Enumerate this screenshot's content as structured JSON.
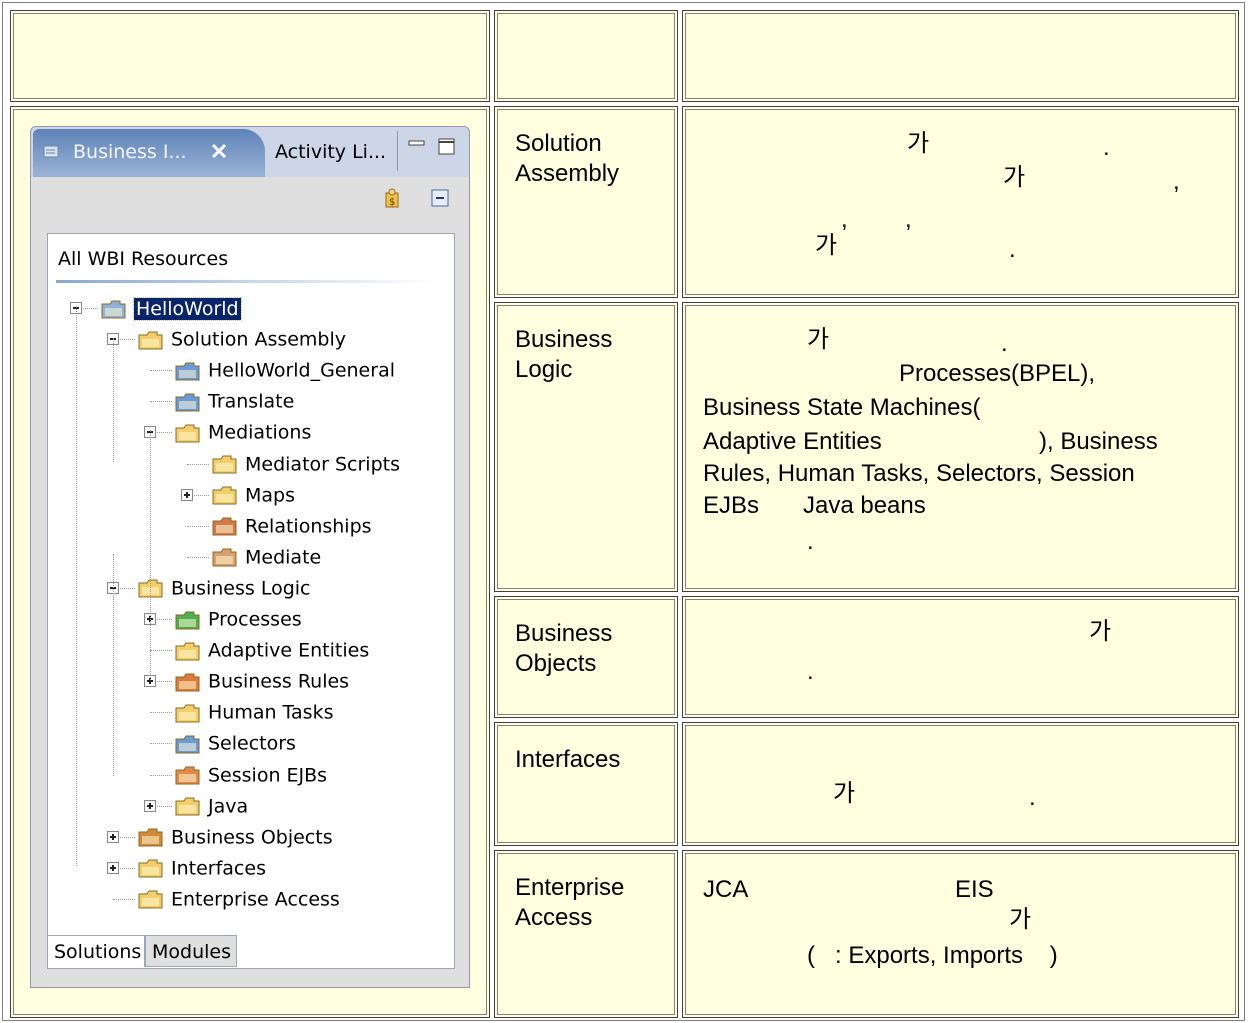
{
  "colors": {
    "cell_bg": "#ffffe0",
    "tab_active": "#5e83b8",
    "selection": "#0a246a"
  },
  "panel": {
    "tab_active_title": "Business I...",
    "tab_inactive_title": "Activity Li...",
    "tree_header": "All WBI Resources",
    "tree": [
      {
        "label": "HelloWorld",
        "icon": "project-icon",
        "selected": true
      },
      {
        "label": "Solution Assembly",
        "icon": "folder-open-icon"
      },
      {
        "label": "HelloWorld_General",
        "icon": "assembly-diagram-icon"
      },
      {
        "label": "Translate",
        "icon": "assembly-diagram-icon"
      },
      {
        "label": "Mediations",
        "icon": "mediation-folder-icon"
      },
      {
        "label": "Mediator Scripts",
        "icon": "folder-icon"
      },
      {
        "label": "Maps",
        "icon": "maps-folder-icon"
      },
      {
        "label": "Relationships",
        "icon": "relationships-icon"
      },
      {
        "label": "Mediate",
        "icon": "mediate-icon"
      },
      {
        "label": "Business Logic",
        "icon": "business-logic-folder-icon"
      },
      {
        "label": "Processes",
        "icon": "processes-folder-icon"
      },
      {
        "label": "Adaptive Entities",
        "icon": "adaptive-entities-icon"
      },
      {
        "label": "Business Rules",
        "icon": "business-rules-icon"
      },
      {
        "label": "Human Tasks",
        "icon": "human-tasks-icon"
      },
      {
        "label": "Selectors",
        "icon": "selectors-icon"
      },
      {
        "label": "Session EJBs",
        "icon": "session-ejb-icon"
      },
      {
        "label": "Java",
        "icon": "java-folder-icon"
      },
      {
        "label": "Business Objects",
        "icon": "business-objects-icon"
      },
      {
        "label": "Interfaces",
        "icon": "interfaces-folder-icon"
      },
      {
        "label": "Enterprise Access",
        "icon": "enterprise-access-icon"
      }
    ],
    "bottom_tabs": [
      "Solutions",
      "Modules"
    ]
  },
  "rows": [
    {
      "label": "Solution\nAssembly",
      "text": [
        {
          "t": "가"
        },
        {
          "t": "."
        },
        {
          "t": "가"
        },
        {
          "t": ","
        },
        {
          "t": ","
        },
        {
          "t": ","
        },
        {
          "t": "가"
        },
        {
          "t": "."
        }
      ]
    },
    {
      "label": "Business\nLogic",
      "text": [
        {
          "t": "가"
        },
        {
          "t": "."
        },
        {
          "t": "Processes(BPEL),"
        },
        {
          "t": "Business State Machines("
        },
        {
          "t": "Adaptive Entities"
        },
        {
          "t": "), Business"
        },
        {
          "t": "Rules, Human Tasks, Selectors, Session"
        },
        {
          "t": "EJBs"
        },
        {
          "t": "Java beans"
        },
        {
          "t": "."
        }
      ]
    },
    {
      "label": "Business\nObjects",
      "text": [
        {
          "t": "가"
        },
        {
          "t": "."
        }
      ]
    },
    {
      "label": "Interfaces",
      "text": [
        {
          "t": "가"
        },
        {
          "t": "."
        }
      ]
    },
    {
      "label": "Enterprise\nAccess",
      "text": [
        {
          "t": "JCA"
        },
        {
          "t": "EIS"
        },
        {
          "t": "가"
        },
        {
          "t": "(   : Exports, Imports    )"
        }
      ]
    }
  ]
}
